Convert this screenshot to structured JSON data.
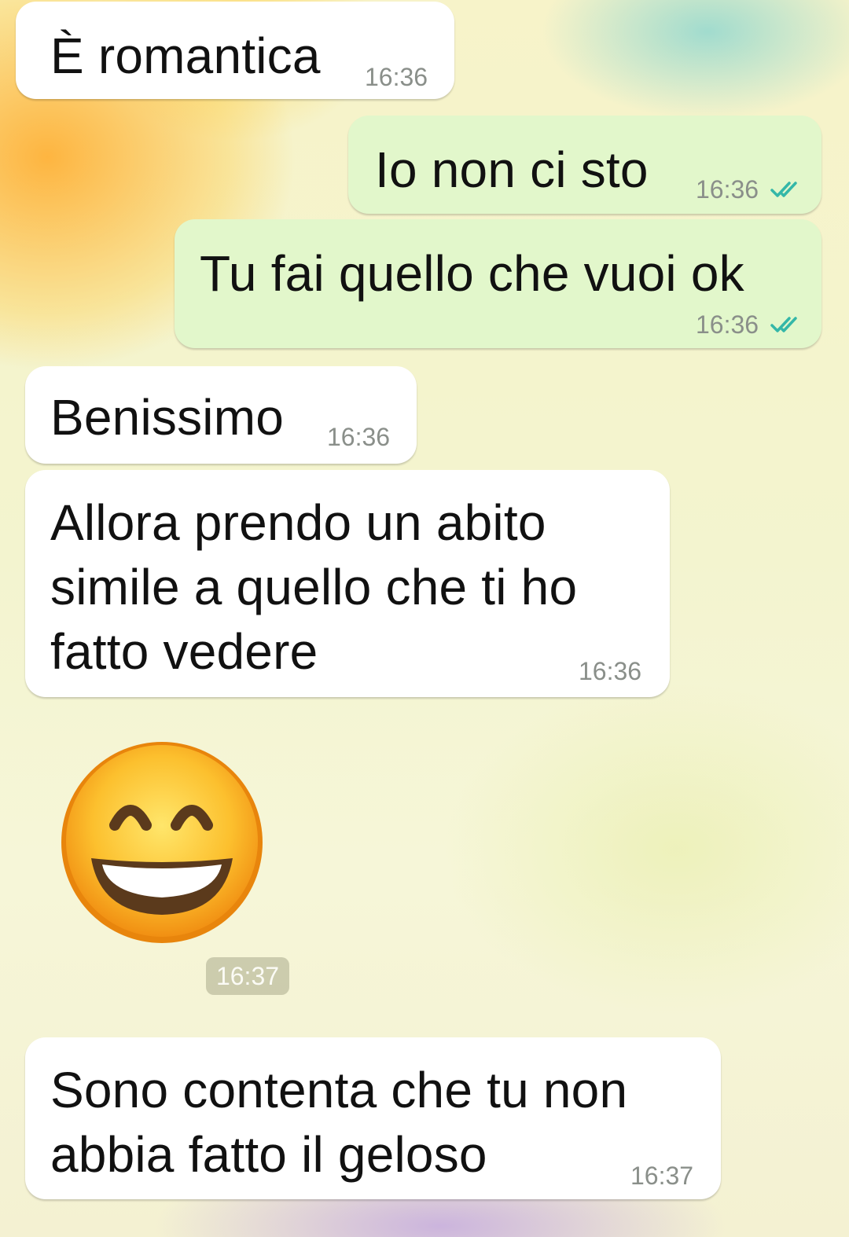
{
  "messages": [
    {
      "direction": "incoming",
      "text": "È romantica",
      "time": "16:36"
    },
    {
      "direction": "outgoing",
      "text": "Io non ci sto",
      "time": "16:36",
      "status": "read"
    },
    {
      "direction": "outgoing",
      "text": "Tu fai quello che vuoi ok",
      "time": "16:36",
      "status": "read"
    },
    {
      "direction": "incoming",
      "text": "Benissimo",
      "time": "16:36"
    },
    {
      "direction": "incoming",
      "text": "Allora prendo un abito simile a quello che ti ho fatto vedere",
      "time": "16:36"
    },
    {
      "direction": "incoming",
      "emoji": "grinning-face-with-smiling-eyes",
      "time": "16:37"
    },
    {
      "direction": "incoming",
      "text": "Sono contenta che tu non abbia fatto il geloso",
      "time": "16:37"
    }
  ],
  "colors": {
    "incoming_bubble": "#ffffff",
    "outgoing_bubble": "#e2f7cb",
    "read_ticks": "#34b7a8",
    "timestamp": "#8a8f8a"
  }
}
